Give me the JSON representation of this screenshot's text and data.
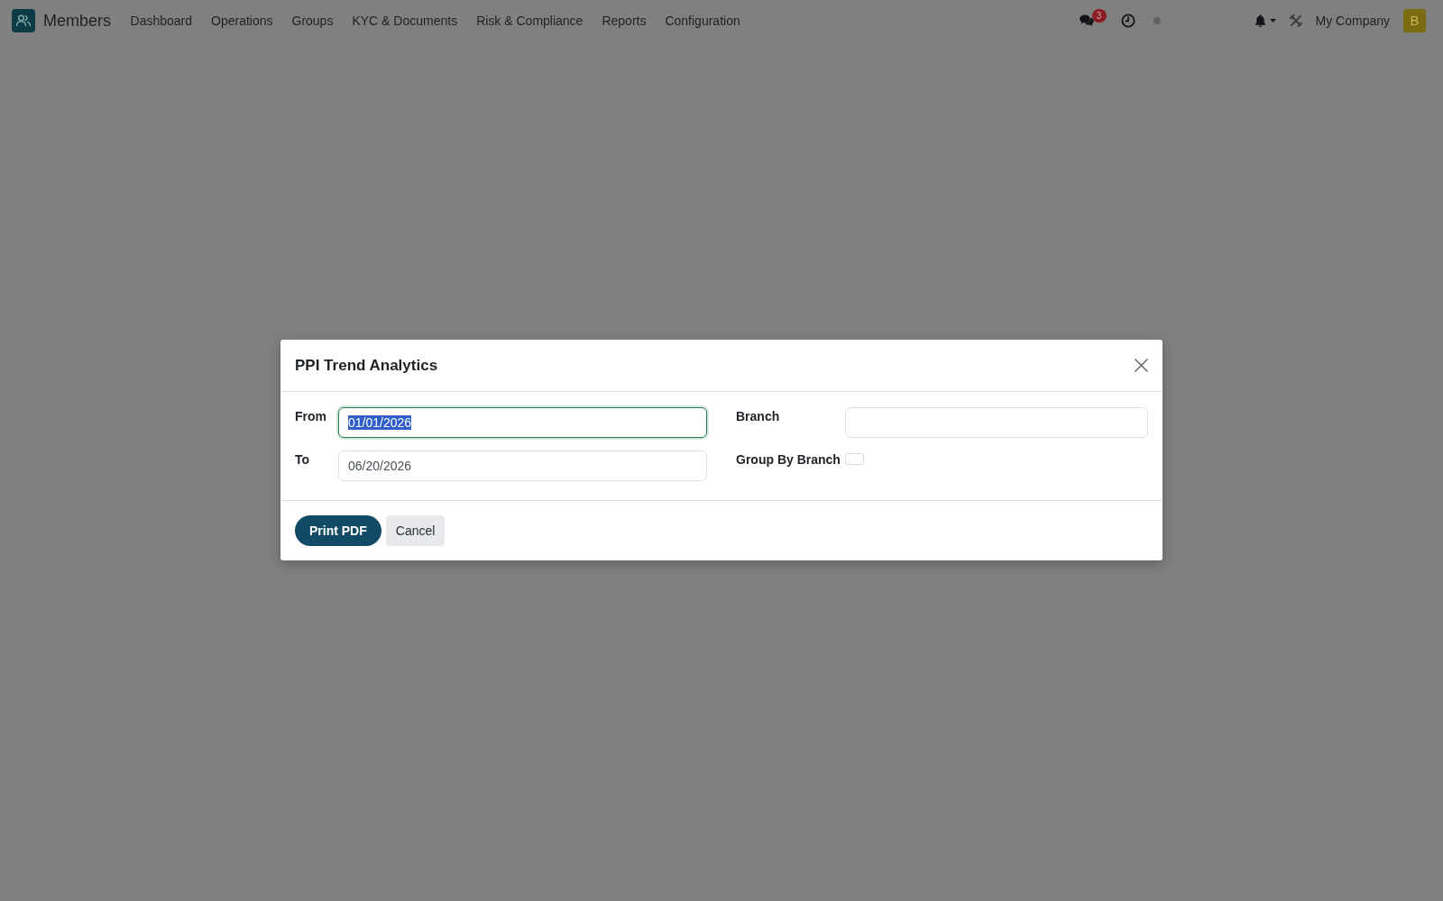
{
  "navbar": {
    "app_name": "Members",
    "menu": [
      "Dashboard",
      "Operations",
      "Groups",
      "KYC & Documents",
      "Risk & Compliance",
      "Reports",
      "Configuration"
    ],
    "unread_count": "3",
    "company": "My Company",
    "avatar_initial": "B"
  },
  "dialog": {
    "title": "PPI Trend Analytics",
    "fields": [
      {
        "kind": "date",
        "label": "From",
        "value": "01/01/2026",
        "focused": true,
        "text_selected": true
      },
      {
        "kind": "text",
        "label": "Branch",
        "focused": false
      },
      {
        "kind": "date",
        "label": "To",
        "value": "06/20/2026",
        "focused": false,
        "text_selected": false
      },
      {
        "kind": "checkbox",
        "label": "Group By Branch",
        "checked": false
      }
    ],
    "buttons": [
      {
        "label": "Print PDF",
        "kind": "primary"
      },
      {
        "label": "Cancel",
        "kind": "secondary"
      }
    ]
  }
}
